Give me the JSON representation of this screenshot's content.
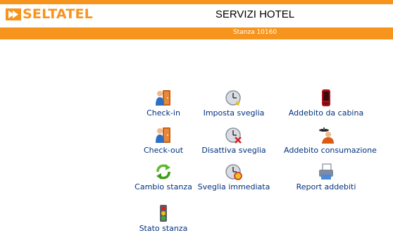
{
  "header": {
    "logo_text": "SELTATEL",
    "title": "SERVIZI HOTEL",
    "room": "Stanza 10160",
    "accent_color": "#f7941d"
  },
  "menu": [
    {
      "label": "Check-in",
      "icon": "door-person-icon"
    },
    {
      "label": "Imposta sveglia",
      "icon": "alarm-clock-icon"
    },
    {
      "label": "Addebito da cabina",
      "icon": "phone-booth-icon"
    },
    {
      "label": "Check-out",
      "icon": "door-person-icon"
    },
    {
      "label": "Disattiva sveglia",
      "icon": "alarm-clock-off-icon"
    },
    {
      "label": "Addebito consumazione",
      "icon": "waiter-icon"
    },
    {
      "label": "Cambio stanza",
      "icon": "refresh-arrows-icon"
    },
    {
      "label": "Sveglia immediata",
      "icon": "alarm-clock-ring-icon"
    },
    {
      "label": "Report addebiti",
      "icon": "printer-report-icon"
    },
    {
      "label": "Stato stanza",
      "icon": "traffic-light-icon"
    }
  ]
}
